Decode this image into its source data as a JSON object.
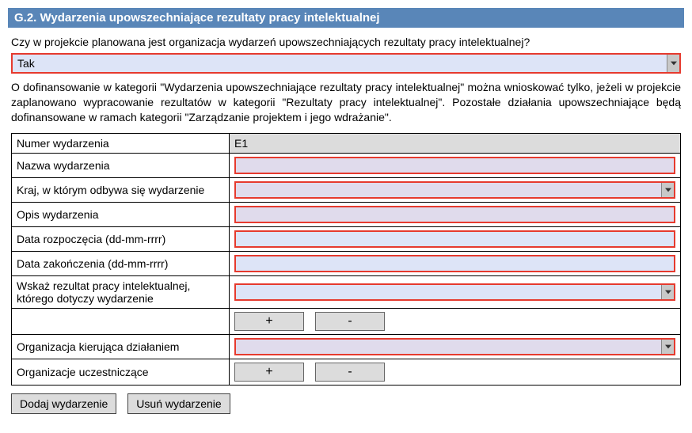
{
  "header": "G.2. Wydarzenia upowszechniające rezultaty pracy intelektualnej",
  "question": "Czy w projekcie planowana jest organizacja wydarzeń upowszechniających rezultaty pracy intelektualnej?",
  "answer": "Tak",
  "info": "O dofinansowanie w kategorii \"Wydarzenia upowszechniające rezultaty pracy intelektualnej\" można wnioskować tylko, jeżeli w projekcie zaplanowano wypracowanie rezultatów w kategorii \"Rezultaty pracy intelektualnej\". Pozostałe działania upowszechniające będą dofinansowane w ramach kategorii \"Zarządzanie projektem i jego wdrażanie\".",
  "rows": {
    "event_number": {
      "label": "Numer wydarzenia",
      "value": "E1"
    },
    "event_name": {
      "label": "Nazwa wydarzenia"
    },
    "country": {
      "label": "Kraj, w którym odbywa się wydarzenie"
    },
    "description": {
      "label": "Opis wydarzenia"
    },
    "start_date": {
      "label": "Data rozpoczęcia (dd-mm-rrrr)"
    },
    "end_date": {
      "label": "Data zakończenia (dd-mm-rrrr)"
    },
    "output": {
      "label": "Wskaż rezultat pracy intelektualnej, którego dotyczy wydarzenie"
    },
    "leading_org": {
      "label": "Organizacja kierująca działaniem"
    },
    "participating_orgs": {
      "label": "Organizacje uczestniczące"
    }
  },
  "buttons": {
    "plus": "+",
    "minus": "-",
    "add_event": "Dodaj wydarzenie",
    "remove_event": "Usuń wydarzenie"
  }
}
